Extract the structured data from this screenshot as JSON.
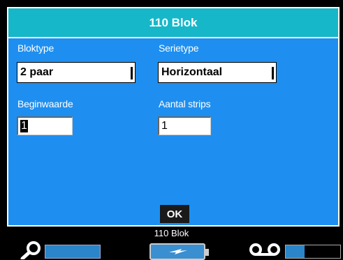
{
  "dialog": {
    "title": "110 Blok",
    "bloktype_label": "Bloktype",
    "bloktype_value": "2 paar",
    "serietype_label": "Serietype",
    "serietype_value": "Horizontaal",
    "beginwaarde_label": "Beginwaarde",
    "beginwaarde_value": "1",
    "aantal_strips_label": "Aantal strips",
    "aantal_strips_value": "1",
    "ok_label": "OK"
  },
  "status": {
    "label_type": "110 Blok",
    "zoom_icon": "zoom-icon",
    "battery_icon": "battery-charging-icon",
    "tape_icon": "tape-cassette-icon",
    "tape_level": 0.35
  },
  "colors": {
    "dialog_bg": "#1e8ff0",
    "titlebar_bg": "#16b7c9",
    "status_bar_fill": "#2a86c8"
  }
}
